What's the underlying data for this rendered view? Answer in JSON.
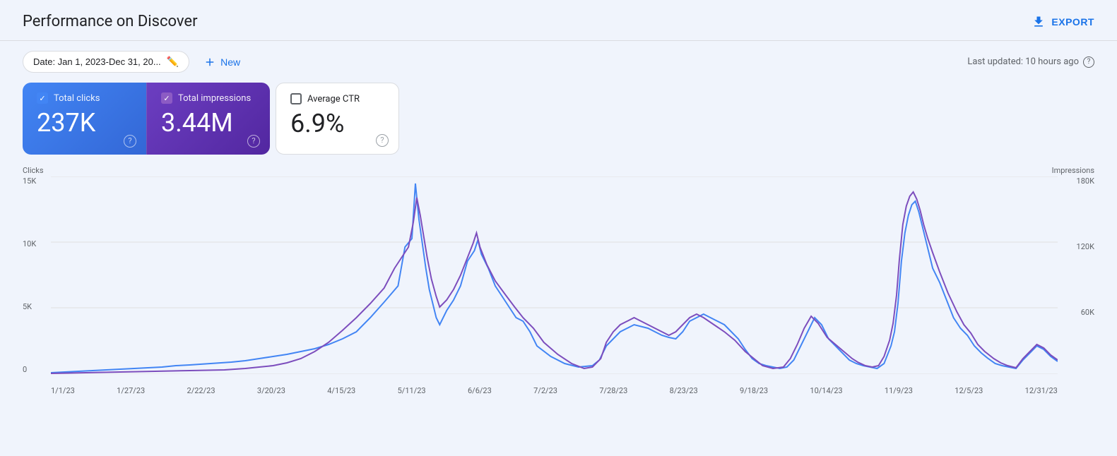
{
  "header": {
    "title": "Performance on Discover",
    "export_label": "EXPORT"
  },
  "filter_bar": {
    "date_label": "Date: Jan 1, 2023-Dec 31, 20...",
    "new_label": "New",
    "last_updated": "Last updated: 10 hours ago"
  },
  "metrics": {
    "clicks": {
      "label": "Total clicks",
      "value": "237K"
    },
    "impressions": {
      "label": "Total impressions",
      "value": "3.44M"
    },
    "ctr": {
      "label": "Average CTR",
      "value": "6.9%"
    }
  },
  "chart": {
    "left_axis_label": "Clicks",
    "right_axis_label": "Impressions",
    "y_left": [
      "15K",
      "10K",
      "5K",
      "0"
    ],
    "y_right": [
      "180K",
      "120K",
      "60K",
      ""
    ],
    "x_labels": [
      "1/1/23",
      "1/27/23",
      "2/22/23",
      "3/20/23",
      "4/15/23",
      "5/11/23",
      "6/6/23",
      "7/2/23",
      "7/28/23",
      "8/23/23",
      "9/18/23",
      "10/14/23",
      "11/9/23",
      "12/5/23",
      "12/31/23"
    ]
  }
}
